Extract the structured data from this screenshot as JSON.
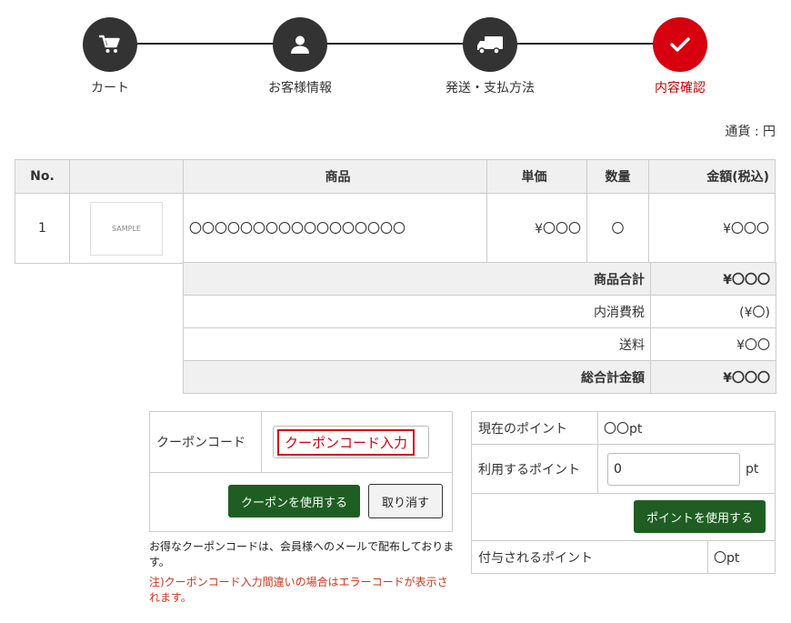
{
  "steps": [
    {
      "label": "カート",
      "icon": "cart-icon"
    },
    {
      "label": "お客様情報",
      "icon": "user-icon"
    },
    {
      "label": "発送・支払方法",
      "icon": "truck-icon"
    },
    {
      "label": "内容確認",
      "icon": "check-icon",
      "active": true
    }
  ],
  "currency": "通貨 : 円",
  "table": {
    "headers": [
      "No.",
      "",
      "商品",
      "単価",
      "数量",
      "金額(税込)"
    ],
    "rows": [
      {
        "no": "1",
        "image_text": "SAMPLE",
        "name": "〇〇〇〇〇〇〇〇〇〇〇〇〇〇〇〇〇",
        "price": "¥〇〇〇",
        "qty": "〇",
        "amount": "¥〇〇〇"
      }
    ]
  },
  "summary": [
    {
      "label": "商品合計",
      "value": "¥〇〇〇"
    },
    {
      "label": "内消費税",
      "value": "(¥〇)"
    },
    {
      "label": "送料",
      "value": "¥〇〇"
    },
    {
      "label": "総合計金額",
      "value": "¥〇〇〇"
    }
  ],
  "coupon": {
    "label": "クーポンコード",
    "input_text": "クーポンコード入力",
    "use_button": "クーポンを使用する",
    "cancel_button": "取り消す",
    "note": "お得なクーポンコードは、会員様へのメールで配布しております。",
    "warning": "注)クーポンコード入力間違いの場合はエラーコードが表示されます。"
  },
  "points": {
    "current_label": "現在のポイント",
    "current_value": "〇〇pt",
    "use_label": "利用するポイント",
    "use_value": "0",
    "unit": "pt",
    "use_button": "ポイントを使用する",
    "granted_label": "付与されるポイント",
    "granted_value": "〇pt"
  },
  "colors": {
    "accent": "#d7000f",
    "step": "#333333",
    "button_green": "#1e5e22"
  }
}
